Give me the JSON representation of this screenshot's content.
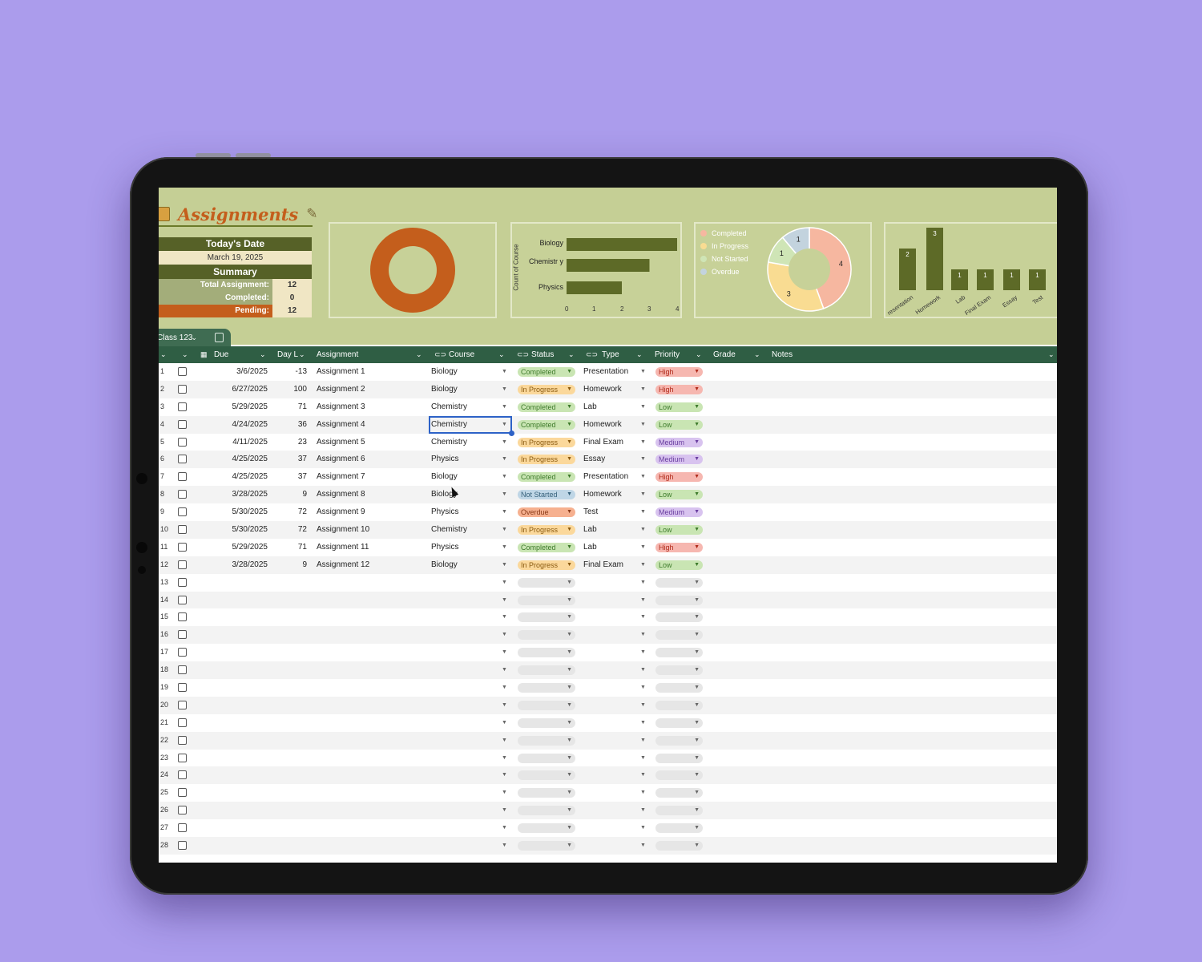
{
  "header": {
    "title": "Assignments",
    "todays_date_label": "Today's Date",
    "todays_date": "March 19, 2025",
    "summary_label": "Summary",
    "total_label": "Total Assignment:",
    "total_value": "12",
    "completed_label": "Completed:",
    "completed_value": "0",
    "pending_label": "Pending:",
    "pending_value": "12"
  },
  "colors": {
    "dashboard_bg": "#c5cf95",
    "header_green": "#2f5e44",
    "accent_orange": "#c45e1c",
    "completed": "#c9e5b3",
    "in_progress": "#fbd89b",
    "not_started": "#bfd6e6",
    "overdue": "#f6b08f",
    "high": "#f6b7b0",
    "low": "#c9e5b3",
    "medium": "#d8c3ef"
  },
  "chart_data": [
    {
      "type": "pie",
      "values": [
        1
      ]
    },
    {
      "type": "bar",
      "orientation": "horizontal",
      "categories": [
        "Biology",
        "Chemistr y",
        "Physics"
      ],
      "values": [
        4,
        3,
        2
      ],
      "ylabel": "Count of Course",
      "xlim": [
        0,
        4
      ],
      "xticks": [
        "0",
        "1",
        "2",
        "3",
        "4"
      ]
    },
    {
      "type": "pie",
      "categories": [
        "Completed",
        "In Progress",
        "Not Started",
        "Overdue"
      ],
      "values": [
        4,
        3,
        1,
        1
      ],
      "legend": "left"
    },
    {
      "type": "bar",
      "categories": [
        "Presentation",
        "Homework",
        "Lab",
        "Final Exam",
        "Essay",
        "Test"
      ],
      "tick_labels": [
        "resentation",
        "Homework",
        "Lab",
        "Final Exam",
        "Essay",
        "Test"
      ],
      "values": [
        2,
        3,
        1,
        1,
        1,
        1
      ]
    }
  ],
  "sheet_tab": {
    "label": "Class 123"
  },
  "columns": {
    "due": "Due",
    "days_left": "Day L",
    "assignment": "Assignment",
    "course": "Course",
    "status": "Status",
    "type": "Type",
    "priority": "Priority",
    "grade": "Grade",
    "notes": "Notes"
  },
  "rows": [
    {
      "num": "1",
      "due": "3/6/2025",
      "days": "-13",
      "assignment": "Assignment 1",
      "course": "Biology",
      "status": "Completed",
      "type": "Presentation",
      "priority": "High"
    },
    {
      "num": "2",
      "due": "6/27/2025",
      "days": "100",
      "assignment": "Assignment 2",
      "course": "Biology",
      "status": "In Progress",
      "type": "Homework",
      "priority": "High"
    },
    {
      "num": "3",
      "due": "5/29/2025",
      "days": "71",
      "assignment": "Assignment 3",
      "course": "Chemistry",
      "status": "Completed",
      "type": "Lab",
      "priority": "Low"
    },
    {
      "num": "4",
      "due": "4/24/2025",
      "days": "36",
      "assignment": "Assignment 4",
      "course": "Chemistry",
      "status": "Completed",
      "type": "Homework",
      "priority": "Low"
    },
    {
      "num": "5",
      "due": "4/11/2025",
      "days": "23",
      "assignment": "Assignment 5",
      "course": "Chemistry",
      "status": "In Progress",
      "type": "Final Exam",
      "priority": "Medium"
    },
    {
      "num": "6",
      "due": "4/25/2025",
      "days": "37",
      "assignment": "Assignment 6",
      "course": "Physics",
      "status": "In Progress",
      "type": "Essay",
      "priority": "Medium"
    },
    {
      "num": "7",
      "due": "4/25/2025",
      "days": "37",
      "assignment": "Assignment 7",
      "course": "Biology",
      "status": "Completed",
      "type": "Presentation",
      "priority": "High"
    },
    {
      "num": "8",
      "due": "3/28/2025",
      "days": "9",
      "assignment": "Assignment 8",
      "course": "Biology",
      "status": "Not Started",
      "type": "Homework",
      "priority": "Low"
    },
    {
      "num": "9",
      "due": "5/30/2025",
      "days": "72",
      "assignment": "Assignment 9",
      "course": "Physics",
      "status": "Overdue",
      "type": "Test",
      "priority": "Medium"
    },
    {
      "num": "10",
      "due": "5/30/2025",
      "days": "72",
      "assignment": "Assignment 10",
      "course": "Chemistry",
      "status": "In Progress",
      "type": "Lab",
      "priority": "Low"
    },
    {
      "num": "11",
      "due": "5/29/2025",
      "days": "71",
      "assignment": "Assignment 11",
      "course": "Physics",
      "status": "Completed",
      "type": "Lab",
      "priority": "High"
    },
    {
      "num": "12",
      "due": "3/28/2025",
      "days": "9",
      "assignment": "Assignment 12",
      "course": "Biology",
      "status": "In Progress",
      "type": "Final Exam",
      "priority": "Low"
    },
    {
      "num": "13"
    },
    {
      "num": "14"
    },
    {
      "num": "15"
    },
    {
      "num": "16"
    },
    {
      "num": "17"
    },
    {
      "num": "18"
    },
    {
      "num": "19"
    },
    {
      "num": "20"
    },
    {
      "num": "21"
    },
    {
      "num": "22"
    },
    {
      "num": "23"
    },
    {
      "num": "24"
    },
    {
      "num": "25"
    },
    {
      "num": "26"
    },
    {
      "num": "27"
    },
    {
      "num": "28"
    }
  ]
}
